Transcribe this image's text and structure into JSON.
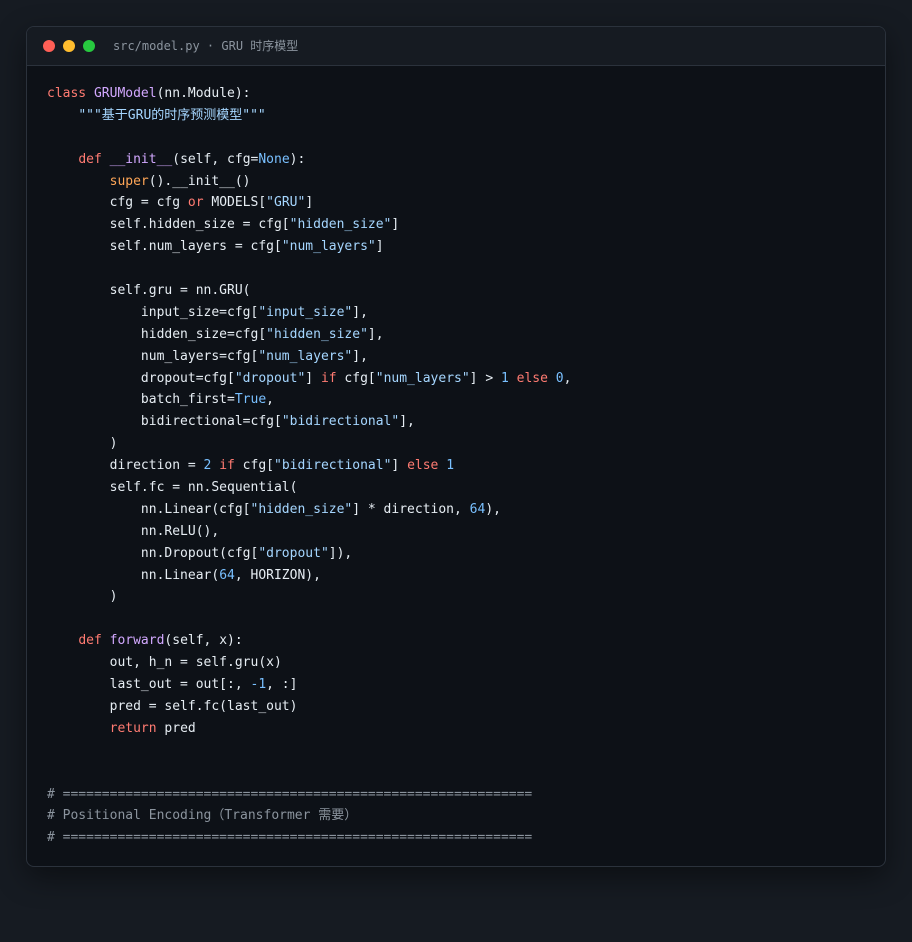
{
  "window": {
    "title": "src/model.py · GRU 时序模型",
    "controls": [
      {
        "name": "close",
        "color": "#ff5f56"
      },
      {
        "name": "minimize",
        "color": "#ffbd2e"
      },
      {
        "name": "maximize",
        "color": "#27c93f"
      }
    ]
  },
  "colors": {
    "default": "#e6edf3",
    "keyword": "#ff7b72",
    "class_name": "#d2a8ff",
    "function_name": "#d2a8ff",
    "builtin": "#ffa657",
    "string": "#a5d6ff",
    "number": "#79c0ff",
    "constant": "#79c0ff",
    "comment": "#8b949e",
    "title_text": "#8b949e"
  },
  "code": [
    [
      [
        "kw",
        "class "
      ],
      [
        "cls",
        "GRUModel"
      ],
      [
        "t",
        "(nn.Module):"
      ]
    ],
    [
      [
        "t",
        "    "
      ],
      [
        "str",
        "\"\"\"基于GRU的时序预测模型\"\"\""
      ]
    ],
    [],
    [
      [
        "t",
        "    "
      ],
      [
        "kw",
        "def "
      ],
      [
        "fn",
        "__init__"
      ],
      [
        "t",
        "(self, cfg="
      ],
      [
        "const",
        "None"
      ],
      [
        "t",
        "):"
      ]
    ],
    [
      [
        "t",
        "        "
      ],
      [
        "bi",
        "super"
      ],
      [
        "t",
        "().__init__()"
      ]
    ],
    [
      [
        "t",
        "        cfg = cfg "
      ],
      [
        "kw",
        "or"
      ],
      [
        "t",
        " MODELS["
      ],
      [
        "str",
        "\"GRU\""
      ],
      [
        "t",
        "]"
      ]
    ],
    [
      [
        "t",
        "        self.hidden_size = cfg["
      ],
      [
        "str",
        "\"hidden_size\""
      ],
      [
        "t",
        "]"
      ]
    ],
    [
      [
        "t",
        "        self.num_layers = cfg["
      ],
      [
        "str",
        "\"num_layers\""
      ],
      [
        "t",
        "]"
      ]
    ],
    [],
    [
      [
        "t",
        "        self.gru = nn.GRU("
      ]
    ],
    [
      [
        "t",
        "            input_size=cfg["
      ],
      [
        "str",
        "\"input_size\""
      ],
      [
        "t",
        "],"
      ]
    ],
    [
      [
        "t",
        "            hidden_size=cfg["
      ],
      [
        "str",
        "\"hidden_size\""
      ],
      [
        "t",
        "],"
      ]
    ],
    [
      [
        "t",
        "            num_layers=cfg["
      ],
      [
        "str",
        "\"num_layers\""
      ],
      [
        "t",
        "],"
      ]
    ],
    [
      [
        "t",
        "            dropout=cfg["
      ],
      [
        "str",
        "\"dropout\""
      ],
      [
        "t",
        "] "
      ],
      [
        "kw",
        "if"
      ],
      [
        "t",
        " cfg["
      ],
      [
        "str",
        "\"num_layers\""
      ],
      [
        "t",
        "] > "
      ],
      [
        "num",
        "1"
      ],
      [
        "t",
        " "
      ],
      [
        "kw",
        "else"
      ],
      [
        "t",
        " "
      ],
      [
        "num",
        "0"
      ],
      [
        "t",
        ","
      ]
    ],
    [
      [
        "t",
        "            batch_first="
      ],
      [
        "const",
        "True"
      ],
      [
        "t",
        ","
      ]
    ],
    [
      [
        "t",
        "            bidirectional=cfg["
      ],
      [
        "str",
        "\"bidirectional\""
      ],
      [
        "t",
        "],"
      ]
    ],
    [
      [
        "t",
        "        )"
      ]
    ],
    [
      [
        "t",
        "        direction = "
      ],
      [
        "num",
        "2"
      ],
      [
        "t",
        " "
      ],
      [
        "kw",
        "if"
      ],
      [
        "t",
        " cfg["
      ],
      [
        "str",
        "\"bidirectional\""
      ],
      [
        "t",
        "] "
      ],
      [
        "kw",
        "else"
      ],
      [
        "t",
        " "
      ],
      [
        "num",
        "1"
      ]
    ],
    [
      [
        "t",
        "        self.fc = nn.Sequential("
      ]
    ],
    [
      [
        "t",
        "            nn.Linear(cfg["
      ],
      [
        "str",
        "\"hidden_size\""
      ],
      [
        "t",
        "] * direction, "
      ],
      [
        "num",
        "64"
      ],
      [
        "t",
        "),"
      ]
    ],
    [
      [
        "t",
        "            nn.ReLU(),"
      ]
    ],
    [
      [
        "t",
        "            nn.Dropout(cfg["
      ],
      [
        "str",
        "\"dropout\""
      ],
      [
        "t",
        "]),"
      ]
    ],
    [
      [
        "t",
        "            nn.Linear("
      ],
      [
        "num",
        "64"
      ],
      [
        "t",
        ", HORIZON),"
      ]
    ],
    [
      [
        "t",
        "        )"
      ]
    ],
    [],
    [
      [
        "t",
        "    "
      ],
      [
        "kw",
        "def "
      ],
      [
        "fn",
        "forward"
      ],
      [
        "t",
        "(self, x):"
      ]
    ],
    [
      [
        "t",
        "        out, h_n = self.gru(x)"
      ]
    ],
    [
      [
        "t",
        "        last_out = out[:, "
      ],
      [
        "num",
        "-1"
      ],
      [
        "t",
        ", :]"
      ]
    ],
    [
      [
        "t",
        "        pred = self.fc(last_out)"
      ]
    ],
    [
      [
        "t",
        "        "
      ],
      [
        "kw",
        "return"
      ],
      [
        "t",
        " pred"
      ]
    ],
    [],
    [],
    [
      [
        "cm",
        "# ============================================================"
      ]
    ],
    [
      [
        "cm",
        "# Positional Encoding（Transformer 需要）"
      ]
    ],
    [
      [
        "cm",
        "# ============================================================"
      ]
    ]
  ]
}
